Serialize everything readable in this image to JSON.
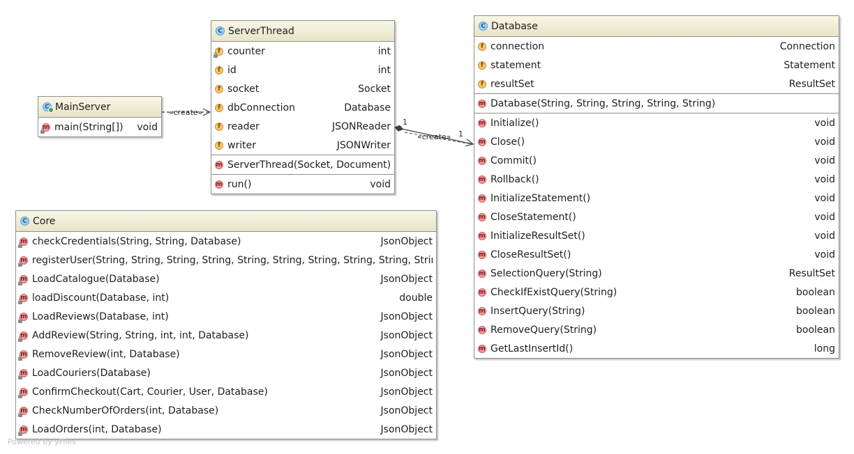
{
  "classes": {
    "main_server": {
      "name": "MainServer",
      "methods": [
        {
          "name": "main(String[])",
          "type": "void",
          "visibility": "package"
        }
      ]
    },
    "server_thread": {
      "name": "ServerThread",
      "fields": [
        {
          "name": "counter",
          "type": "int",
          "visibility": "package"
        },
        {
          "name": "id",
          "type": "int",
          "visibility": "private"
        },
        {
          "name": "socket",
          "type": "Socket",
          "visibility": "private"
        },
        {
          "name": "dbConnection",
          "type": "Database",
          "visibility": "private"
        },
        {
          "name": "reader",
          "type": "JSONReader",
          "visibility": "private"
        },
        {
          "name": "writer",
          "type": "JSONWriter",
          "visibility": "private"
        }
      ],
      "constructors": [
        {
          "name": "ServerThread(Socket, Document)",
          "type": "",
          "visibility": "private"
        }
      ],
      "methods": [
        {
          "name": "run()",
          "type": "void",
          "visibility": "private"
        }
      ]
    },
    "database": {
      "name": "Database",
      "fields": [
        {
          "name": "connection",
          "type": "Connection",
          "visibility": "private"
        },
        {
          "name": "statement",
          "type": "Statement",
          "visibility": "private"
        },
        {
          "name": "resultSet",
          "type": "ResultSet",
          "visibility": "private"
        }
      ],
      "constructors": [
        {
          "name": "Database(String, String, String, String, String)",
          "type": "",
          "visibility": "private"
        }
      ],
      "methods": [
        {
          "name": "Initialize()",
          "type": "void",
          "visibility": "private"
        },
        {
          "name": "Close()",
          "type": "void",
          "visibility": "private"
        },
        {
          "name": "Commit()",
          "type": "void",
          "visibility": "private"
        },
        {
          "name": "Rollback()",
          "type": "void",
          "visibility": "private"
        },
        {
          "name": "InitializeStatement()",
          "type": "void",
          "visibility": "private"
        },
        {
          "name": "CloseStatement()",
          "type": "void",
          "visibility": "private"
        },
        {
          "name": "InitializeResultSet()",
          "type": "void",
          "visibility": "private"
        },
        {
          "name": "CloseResultSet()",
          "type": "void",
          "visibility": "private"
        },
        {
          "name": "SelectionQuery(String)",
          "type": "ResultSet",
          "visibility": "private"
        },
        {
          "name": "CheckIfExistQuery(String)",
          "type": "boolean",
          "visibility": "private"
        },
        {
          "name": "InsertQuery(String)",
          "type": "boolean",
          "visibility": "private"
        },
        {
          "name": "RemoveQuery(String)",
          "type": "boolean",
          "visibility": "private"
        },
        {
          "name": "GetLastInsertId()",
          "type": "long",
          "visibility": "private"
        }
      ]
    },
    "core": {
      "name": "Core",
      "methods": [
        {
          "name": "checkCredentials(String, String, Database)",
          "type": "JsonObject",
          "visibility": "package"
        },
        {
          "name": "registerUser(String, String, String, String, String, String, String, String, String, String, String, Database)",
          "type": "",
          "visibility": "package"
        },
        {
          "name": "LoadCatalogue(Database)",
          "type": "JsonObject",
          "visibility": "package"
        },
        {
          "name": "loadDiscount(Database, int)",
          "type": "double",
          "visibility": "package"
        },
        {
          "name": "LoadReviews(Database, int)",
          "type": "JsonObject",
          "visibility": "package"
        },
        {
          "name": "AddReview(String, String, int, int, Database)",
          "type": "JsonObject",
          "visibility": "package"
        },
        {
          "name": "RemoveReview(int, Database)",
          "type": "JsonObject",
          "visibility": "package"
        },
        {
          "name": "LoadCouriers(Database)",
          "type": "JsonObject",
          "visibility": "package"
        },
        {
          "name": "ConfirmCheckout(Cart, Courier, User, Database)",
          "type": "JsonObject",
          "visibility": "package"
        },
        {
          "name": "CheckNumberOfOrders(int, Database)",
          "type": "JsonObject",
          "visibility": "package"
        },
        {
          "name": "LoadOrders(int, Database)",
          "type": "JsonObject",
          "visibility": "package"
        }
      ]
    }
  },
  "relations": {
    "main_to_thread": {
      "stereotype": "«create»"
    },
    "thread_to_database": {
      "stereotype": "«create»",
      "source_multiplicity": "1",
      "target_multiplicity": "1"
    }
  },
  "icons": {
    "class": "C",
    "field": "f",
    "method": "m"
  },
  "footer": "Powered by yFiles",
  "colors": {
    "header_top": "#f8f6e6",
    "header_bottom": "#e8e4c8",
    "border": "#8f8f8f",
    "class_icon": "#9fcff2",
    "field_icon": "#f6c86a",
    "method_icon": "#f29b9b"
  }
}
